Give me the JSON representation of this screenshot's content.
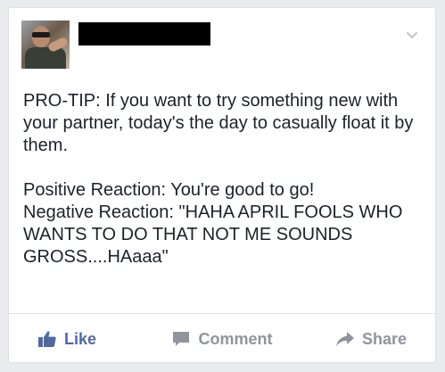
{
  "post": {
    "paragraphs": [
      "PRO-TIP: If you want to try something new with your partner, today's the day to casually float it by them.",
      "Positive Reaction:  You're good to go!\nNegative Reaction: \"HAHA APRIL FOOLS WHO WANTS TO DO THAT NOT ME SOUNDS GROSS....HAaaa\""
    ]
  },
  "actions": {
    "like": "Like",
    "comment": "Comment",
    "share": "Share"
  },
  "colors": {
    "like_blue": "#4e69a2",
    "action_gray": "#90949c",
    "text": "#1d2129"
  }
}
